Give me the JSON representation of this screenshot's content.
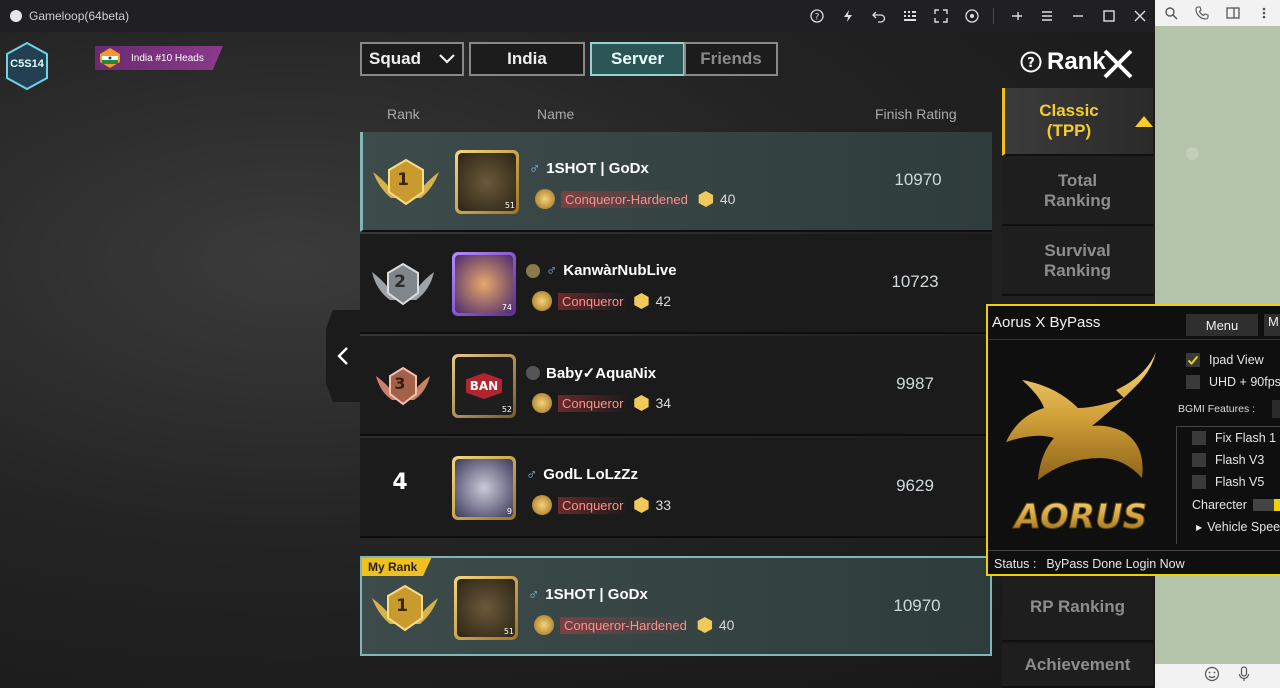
{
  "window": {
    "title": "Gameloop(64beta)",
    "toolbar_icons": [
      "help-icon",
      "boost-icon",
      "back-icon",
      "keyboard-icon",
      "fullscreen-icon",
      "controller-icon"
    ],
    "window_icons": [
      "pin-icon",
      "menu-icon",
      "minimize-icon",
      "maximize-icon",
      "close-icon"
    ]
  },
  "browser_strip": {
    "top_icons": [
      "search-icon",
      "phone-icon",
      "sidebar-icon",
      "more-icon"
    ],
    "bottom_icons": [
      "emoji-icon",
      "mic-icon"
    ]
  },
  "game": {
    "season_badge": "C5S14",
    "country_badge": "India #10 Heads",
    "filters": {
      "mode": "Squad",
      "region": "India",
      "tab_server": "Server",
      "tab_friends": "Friends"
    },
    "rank_title": "Rank",
    "table_headers": {
      "rank": "Rank",
      "name": "Name",
      "rating": "Finish Rating"
    },
    "rows": [
      {
        "rank": "1",
        "name": "1SHOT | GoDx",
        "level": "51",
        "tier": "Conqueror-Hardened",
        "stars": "40",
        "score": "10970"
      },
      {
        "rank": "2",
        "name": "KanwàrNubLive",
        "level": "74",
        "tier": "Conqueror",
        "stars": "42",
        "score": "10723"
      },
      {
        "rank": "3",
        "name": "Baby✓AquaNix",
        "level": "52",
        "tier": "Conqueror",
        "stars": "34",
        "score": "9987",
        "avatar_text": "BAN"
      },
      {
        "rank": "4",
        "name": "GodL  LoLzZz",
        "level": "9",
        "tier": "Conqueror",
        "stars": "33",
        "score": "9629"
      }
    ],
    "my_rank": {
      "tag": "My Rank",
      "rank": "1",
      "name": "1SHOT | GoDx",
      "level": "51",
      "tier": "Conqueror-Hardened",
      "stars": "40",
      "score": "10970"
    },
    "categories": [
      {
        "label": "Classic (TPP)",
        "active": true
      },
      {
        "label": "Total Ranking"
      },
      {
        "label": "Survival Ranking"
      },
      {
        "label": "RP Ranking"
      },
      {
        "label": "Achievement"
      }
    ]
  },
  "panel": {
    "title": "Aorus X ByPass",
    "menu_button": "Menu",
    "menu_button2": "M",
    "logo_text": "AORUS",
    "options": {
      "ipad_view": "Ipad View",
      "uhd": "UHD + 90fps",
      "features_label": "BGMI Features :",
      "fix_flash": "Fix Flash 1",
      "flash_v3": "Flash V3",
      "flash_v5": "Flash V5",
      "charecter": "Charecter",
      "vehicle_speed": "Vehicle Speed"
    },
    "status_label": "Status :",
    "status_text": "ByPass Done Login Now",
    "accent": "#f0d000"
  }
}
